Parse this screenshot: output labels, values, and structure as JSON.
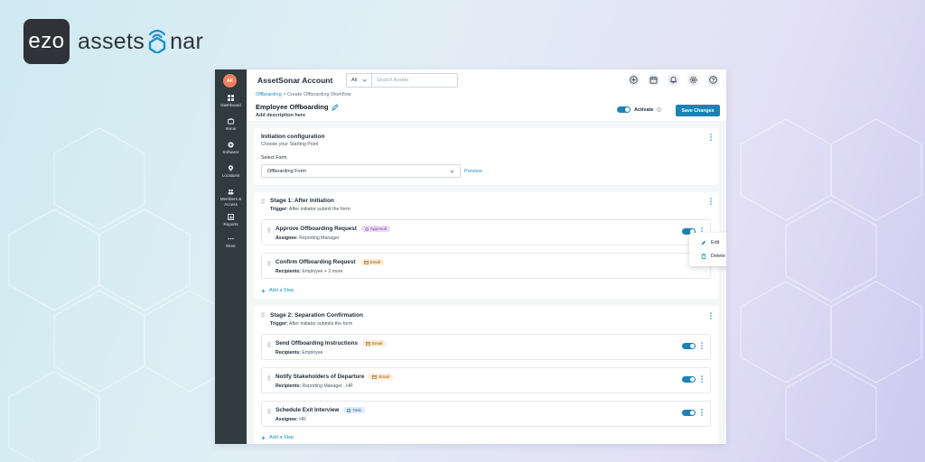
{
  "brand": {
    "logo_box_text": "ezo",
    "name_prefix": "assets",
    "name_suffix": "nar",
    "colors": {
      "logo_bg": "#2f3237",
      "sonar_accent": "#1b8fc9"
    }
  },
  "sidebar": {
    "avatar_initials": "AF",
    "items": [
      {
        "label": "Dashboard",
        "icon": "dashboard-icon"
      },
      {
        "label": "Items",
        "icon": "items-icon"
      },
      {
        "label": "Software",
        "icon": "software-icon"
      },
      {
        "label": "Locations",
        "icon": "location-pin-icon"
      },
      {
        "label_line1": "Members &",
        "label_line2": "Access",
        "icon": "members-icon"
      },
      {
        "label": "Reports",
        "icon": "reports-icon"
      },
      {
        "label": "More",
        "icon": "more-icon"
      }
    ]
  },
  "topbar": {
    "account_name": "AssetSonar Account",
    "search_scope": "All",
    "search_placeholder": "Search Assets",
    "icons": [
      "add-circle-icon",
      "calendar-icon",
      "bell-icon",
      "gear-icon",
      "help-icon"
    ]
  },
  "header": {
    "breadcrumb_link": "Offboarding",
    "breadcrumb_sep": ">",
    "breadcrumb_current": "Create Offboarding Workflow",
    "title": "Employee Offboarding",
    "description": "Add description here",
    "activate_label": "Activate",
    "activate_on": true,
    "save_label": "Save Changes"
  },
  "initiation": {
    "title": "Initiation configuration",
    "subtitle": "Choose your Starting Point",
    "select_label": "Select Form",
    "select_value": "Offboarding Form",
    "preview_label": "Preview"
  },
  "stages": [
    {
      "title": "Stage 1: After Initiation",
      "trigger_label": "Trigger:",
      "trigger_text": "After initiator submit the form",
      "steps": [
        {
          "title": "Approve Offboarding Request",
          "badge": "Approval",
          "sub_label": "Assignee:",
          "sub_text": "Reporting Manager",
          "enabled": true
        },
        {
          "title": "Confirm Offboarding Request",
          "badge": "Email",
          "sub_label": "Recipients:",
          "sub_text": "Employee + 2 more",
          "enabled": true
        }
      ],
      "add_step_label": "Add a Step"
    },
    {
      "title": "Stage 2: Separation Confirmation",
      "trigger_label": "Trigger:",
      "trigger_text": "After initiator submits the form",
      "steps": [
        {
          "title": "Send Offboarding Instructions",
          "badge": "Email",
          "sub_label": "Recipients:",
          "sub_text": "Employee",
          "enabled": true
        },
        {
          "title": "Notify Stakeholders of Departure",
          "badge": "Email",
          "sub_label": "Recipients:",
          "sub_text": "Reporting Manager , HR",
          "enabled": true
        },
        {
          "title": "Schedule Exit Interview",
          "badge": "Task",
          "sub_label": "Assignee:",
          "sub_text": "HR",
          "enabled": true
        }
      ],
      "add_step_label": "Add a Step"
    }
  ],
  "context_menu": {
    "edit_label": "Edit",
    "delete_label": "Delete"
  },
  "colors": {
    "primary": "#1b82b6",
    "sidebar_bg": "#2f3b3f",
    "avatar": "#ef7f5d"
  }
}
